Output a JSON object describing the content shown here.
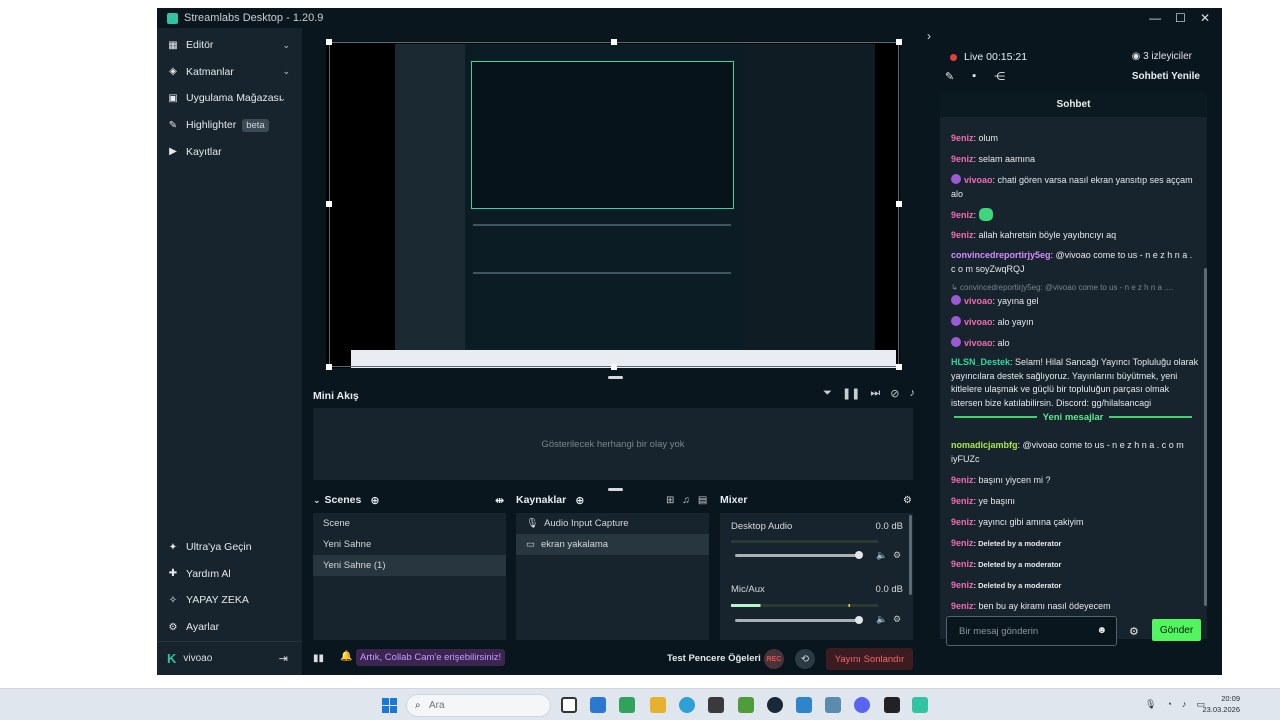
{
  "window": {
    "title": "Streamlabs Desktop - 1.20.9",
    "controls": [
      "—",
      "☐",
      "✕"
    ]
  },
  "sidebar": {
    "top_items": [
      {
        "label": "Editör",
        "icon": "editor-icon",
        "chevron": true
      },
      {
        "label": "Katmanlar",
        "icon": "layers-icon",
        "chevron": true
      },
      {
        "label": "Uygulama Mağazası",
        "icon": "app-store-icon",
        "chevron": true
      },
      {
        "label": "Highlighter",
        "icon": "highlighter-icon",
        "badge": "beta"
      },
      {
        "label": "Kayıtlar",
        "icon": "recordings-icon"
      }
    ],
    "bottom_items": [
      {
        "label": "Ultra'ya Geçin",
        "icon": "ultra-icon"
      },
      {
        "label": "Yardım Al",
        "icon": "help-icon"
      },
      {
        "label": "YAPAY ZEKA",
        "icon": "ai-icon"
      },
      {
        "label": "Ayarlar",
        "icon": "settings-icon"
      }
    ],
    "user": {
      "name": "vivoao",
      "logout_icon": "logout-icon"
    }
  },
  "mini_flow": {
    "title": "Mini Akış",
    "empty_text": "Gösterilecek herhangi bir olay yok"
  },
  "scenes": {
    "title": "Scenes",
    "items": [
      "Scene",
      "Yeni Sahne",
      "Yeni Sahne (1)"
    ],
    "selected": 2
  },
  "sources": {
    "title": "Kaynaklar",
    "items": [
      {
        "label": "Audio Input Capture",
        "icon": "mic-icon"
      },
      {
        "label": "ekran yakalama",
        "icon": "monitor-icon"
      }
    ],
    "selected": 1
  },
  "mixer": {
    "title": "Mixer",
    "channels": [
      {
        "name": "Desktop Audio",
        "db": "0.0 dB",
        "volume": 1.0
      },
      {
        "name": "Mic/Aux",
        "db": "0.0 dB",
        "volume": 1.0
      }
    ]
  },
  "footer": {
    "collab": "Artık, Collab Cam'e erişebilirsiniz!",
    "test_windows": "Test Pencere Öğeleri",
    "rec": "REC",
    "end_stream": "Yayını Sonlandır"
  },
  "chat_header": {
    "live": "Live 00:15:21",
    "viewers": "3 izleyiciler",
    "refresh": "Sohbeti Yenile",
    "title": "Sohbet"
  },
  "chat": {
    "messages": [
      {
        "user": "9eniz",
        "text": ": olum"
      },
      {
        "user": "9eniz",
        "text": ": selam aamına"
      },
      {
        "user": "vivoao",
        "text": ": chati gören varsa nasıl ekran yansıtıp ses aççam alo"
      },
      {
        "user": "9eniz",
        "text": ":"
      },
      {
        "user": "9eniz",
        "text": ": allah kahretsin böyle yayıbncıyı aq"
      },
      {
        "user": "convincedreportirjy5eg",
        "text": ": @vivoao come to us - n e z h n a . c o m soyZwqRQJ"
      },
      {
        "reply": "convincedreportirjy5eg: @vivoao come to us - n e z h n a ...."
      },
      {
        "user": "vivoao",
        "text": ": yayına gel"
      },
      {
        "user": "vivoao",
        "text": ": alo yayın"
      },
      {
        "user": "vivoao",
        "text": ": alo"
      },
      {
        "user": "HLSN_Destek",
        "text": ": Selam! Hilal Sancağı Yayıncı Topluluğu olarak yayıncılara destek sağlıyoruz. Yayınlarını büyütmek, yeni kitlelere ulaşmak ve güçlü bir topluluğun parçası olmak istersen bize katılabilirsin. Discord: gg/hilalsancagi"
      },
      {
        "user": "nomadicjambfg",
        "text": ": @vivoao come to us - n e z h n a . c o m iyFUZc"
      },
      {
        "user": "9eniz",
        "text": ": başını yiycen mi ?"
      },
      {
        "user": "9eniz",
        "text": ": ye başını"
      },
      {
        "user": "9eniz",
        "text": ": yayıncı gibi amına çakiyim"
      },
      {
        "user": "9eniz",
        "text": ": Deleted by a moderator"
      },
      {
        "user": "9eniz",
        "text": ": Deleted by a moderator"
      },
      {
        "user": "9eniz",
        "text": ": Deleted by a moderator"
      },
      {
        "user": "9eniz",
        "text": ": ben bu ay kiramı nasıl ödeyecem"
      }
    ],
    "new_messages": "Yeni mesajlar",
    "input_placeholder": "Bir mesaj gönderin",
    "send": "Gönder"
  },
  "taskbar": {
    "search": "Ara",
    "time": "20:09",
    "date": "23.03.2026"
  },
  "colors": {
    "accent": "#31c3a2",
    "send": "#51f55d",
    "danger": "#f2686a",
    "bg": "#09161d",
    "panel": "#17242d"
  }
}
